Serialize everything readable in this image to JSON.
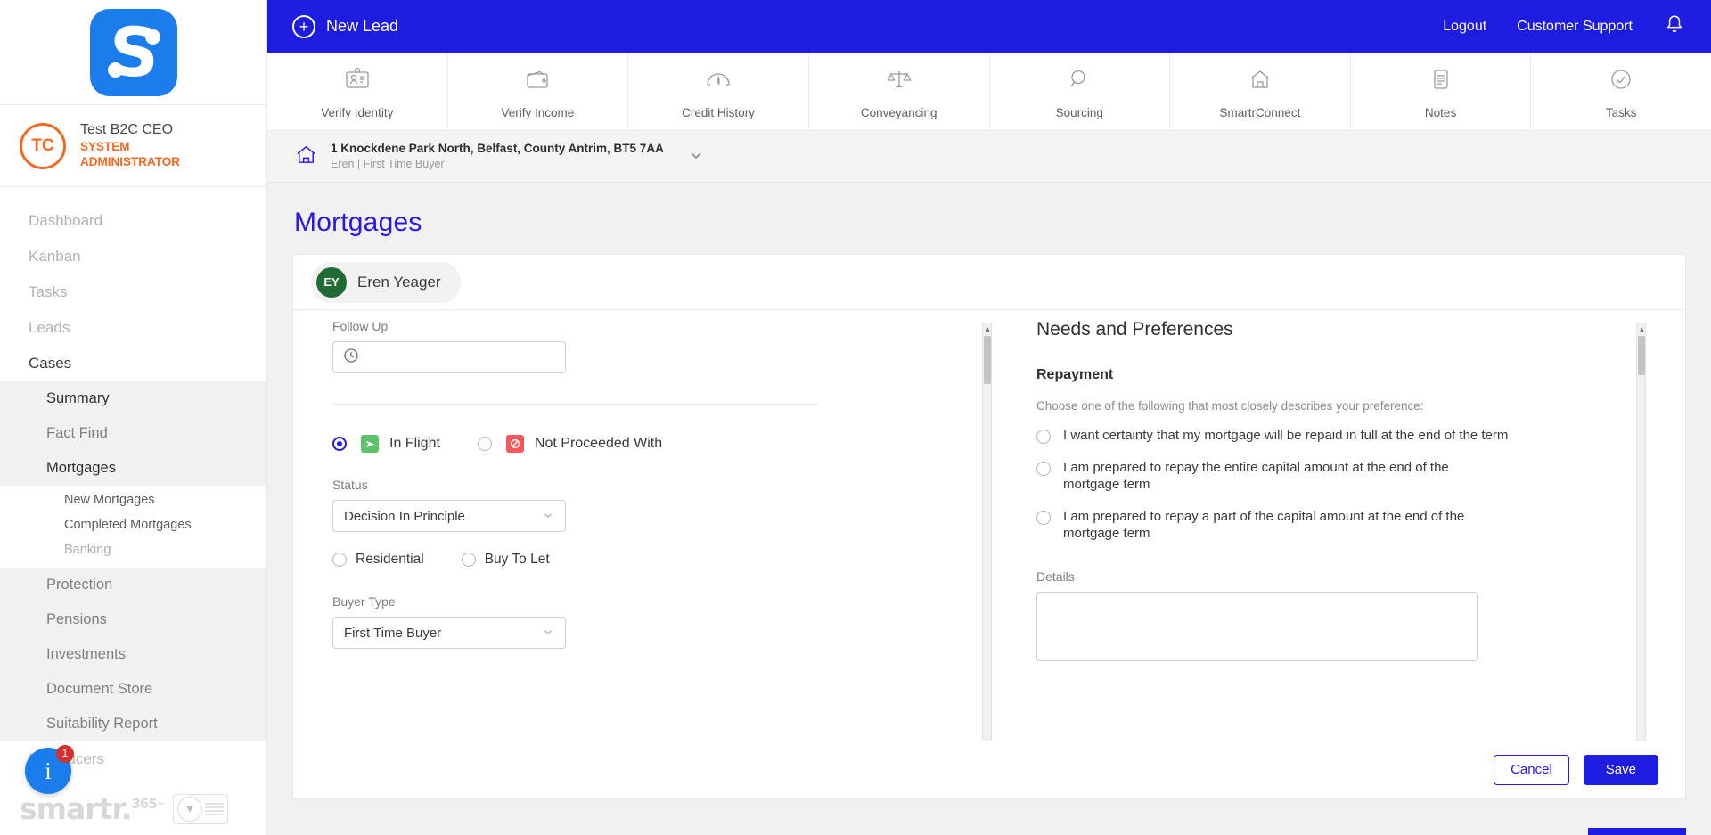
{
  "sidebar": {
    "logo": {
      "icon": "smartr-s-logo",
      "alt": "S"
    },
    "user": {
      "initials": "TC",
      "name": "Test B2C CEO",
      "role": "SYSTEM ADMINISTRATOR"
    },
    "nav": [
      {
        "label": "Dashboard"
      },
      {
        "label": "Kanban"
      },
      {
        "label": "Tasks"
      },
      {
        "label": "Leads"
      },
      {
        "label": "Cases"
      }
    ],
    "case_nav": [
      {
        "label": "Summary"
      },
      {
        "label": "Fact Find"
      },
      {
        "label": "Mortgages"
      }
    ],
    "mortgage_nav": [
      {
        "label": "New Mortgages"
      },
      {
        "label": "Completed Mortgages"
      },
      {
        "label": "Banking"
      }
    ],
    "case_nav2": [
      {
        "label": "Protection"
      },
      {
        "label": "Pensions"
      },
      {
        "label": "Investments"
      },
      {
        "label": "Document Store"
      },
      {
        "label": "Suitability Report"
      }
    ],
    "tail_nav": [
      {
        "label": "Introducers"
      }
    ],
    "footer": {
      "brand": "smartr",
      "brand_sup": "365",
      "brand_tm": "™"
    },
    "info_fab": {
      "icon": "info-icon",
      "glyph": "i",
      "badge": "1"
    }
  },
  "topbar": {
    "new_lead": "New Lead",
    "logout": "Logout",
    "customer_support": "Customer Support",
    "bell_icon": "notification-bell-icon",
    "bg": "#1d1ce0"
  },
  "tabs": [
    {
      "label": "Verify Identity",
      "icon": "id-card-icon"
    },
    {
      "label": "Verify Income",
      "icon": "wallet-icon"
    },
    {
      "label": "Credit History",
      "icon": "gauge-icon"
    },
    {
      "label": "Conveyancing",
      "icon": "scales-icon"
    },
    {
      "label": "Sourcing",
      "icon": "magnifier-icon"
    },
    {
      "label": "SmartrConnect",
      "icon": "house-icon"
    },
    {
      "label": "Notes",
      "icon": "notes-icon"
    },
    {
      "label": "Tasks",
      "icon": "check-circle-icon"
    }
  ],
  "address": {
    "icon": "home-outline-icon",
    "line1": "1 Knockdene Park North, Belfast, County Antrim, BT5 7AA",
    "line2": "Eren | First Time Buyer",
    "chevron": "chevron-down-icon"
  },
  "page": {
    "title": "Mortgages"
  },
  "client": {
    "initials": "EY",
    "name": "Eren Yeager",
    "avatar_color": "#1f6b33"
  },
  "form": {
    "follow_up": {
      "label": "Follow Up",
      "value": "",
      "icon": "clock-icon"
    },
    "flight_options": [
      {
        "label": "In Flight",
        "checked": true,
        "badge_color": "#5ec26a",
        "badge_icon": "send-icon"
      },
      {
        "label": "Not Proceeded With",
        "checked": false,
        "badge_color": "#f4585c",
        "badge_icon": "no-entry-icon"
      }
    ],
    "status": {
      "label": "Status",
      "value": "Decision In Principle",
      "chevron": "chevron-down-icon"
    },
    "property_type": [
      {
        "label": "Residential",
        "checked": false
      },
      {
        "label": "Buy To Let",
        "checked": false
      }
    ],
    "buyer_type": {
      "label": "Buyer Type",
      "value": "First Time Buyer",
      "chevron": "chevron-down-icon"
    }
  },
  "needs": {
    "title": "Needs and Preferences",
    "section": "Repayment",
    "help": "Choose one of the following that most closely describes your preference:",
    "options": [
      {
        "label": "I want certainty that my mortgage will be repaid in full at the end of the term",
        "checked": false
      },
      {
        "label": "I am prepared to repay the entire capital amount at the end of the mortgage term",
        "checked": false
      },
      {
        "label": "I am prepared to repay a part of the capital amount at the end of the mortgage term",
        "checked": false
      }
    ],
    "details_label": "Details",
    "details_value": ""
  },
  "footer": {
    "cancel": "Cancel",
    "save": "Save"
  },
  "annotation": {
    "type": "red-arrow",
    "color": "#e81c1c",
    "points_at": "status-select"
  }
}
